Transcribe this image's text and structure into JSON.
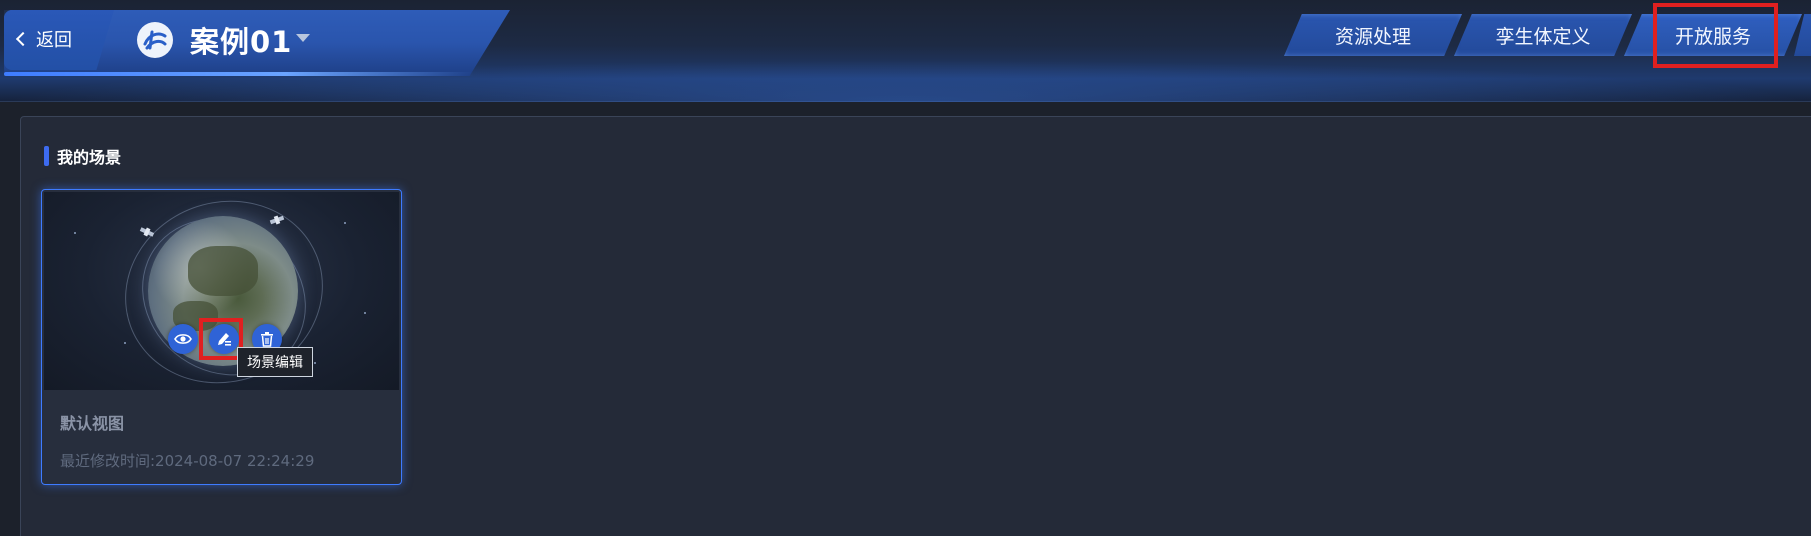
{
  "header": {
    "back_label": "返回",
    "project_title": "案例01",
    "logo_icon": "globe-logo-icon",
    "tabs": [
      {
        "label": "资源处理"
      },
      {
        "label": "孪生体定义"
      },
      {
        "label": "开放服务"
      }
    ]
  },
  "main": {
    "section_title": "我的场景",
    "scene": {
      "name": "默认视图",
      "modified_prefix": "最近修改时间:",
      "modified_time": "2024-08-07 22:24:29",
      "modified_text": "最近修改时间:2024-08-07 22:24:29",
      "actions": [
        {
          "icon": "eye-icon"
        },
        {
          "icon": "edit-icon"
        },
        {
          "icon": "trash-icon"
        }
      ],
      "tooltip": "场景编辑"
    }
  },
  "colors": {
    "accent": "#2f63d6",
    "highlight": "#e02020",
    "background": "#1c212b",
    "panel": "#242a38"
  }
}
